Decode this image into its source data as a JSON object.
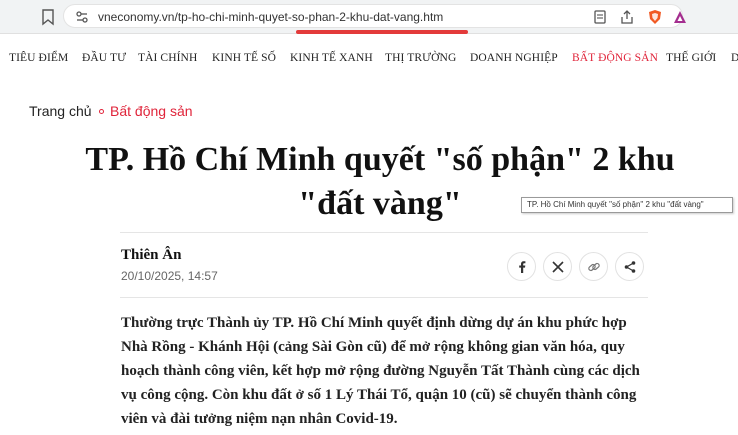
{
  "browser": {
    "url": "vneconomy.vn/tp-ho-chi-minh-quyet-so-phan-2-khu-dat-vang.htm",
    "icons": [
      "bookmark-icon",
      "site-settings-icon",
      "reader-mode-icon",
      "share-icon",
      "brave-shield-icon",
      "brave-rewards-icon"
    ]
  },
  "nav": {
    "items": [
      {
        "label": "TIÊU ĐIỂM"
      },
      {
        "label": "ĐẦU TƯ"
      },
      {
        "label": "TÀI CHÍNH"
      },
      {
        "label": "KINH TẾ SỐ"
      },
      {
        "label": "KINH TẾ XANH"
      },
      {
        "label": "THỊ TRƯỜNG"
      },
      {
        "label": "DOANH NGHIỆP"
      },
      {
        "label": "BẤT ĐỘNG SẢN"
      },
      {
        "label": "THẾ GIỚI"
      },
      {
        "label": "D"
      }
    ],
    "active_color": "#e0243a"
  },
  "breadcrumb": {
    "home": "Trang chủ",
    "category": "Bất động sản"
  },
  "article": {
    "title_line1": "TP. Hồ Chí Minh quyết \"số phận\" 2 khu",
    "title_line2": "\"đất vàng\"",
    "tooltip": "TP. Hồ Chí Minh quyết \"số phận\" 2 khu \"đất vàng\"",
    "author": "Thiên Ân",
    "date": "20/10/2025, 14:57",
    "share_icons": [
      "facebook-icon",
      "x-icon",
      "link-icon",
      "share-icon"
    ],
    "sapo": "Thường trực Thành ủy TP. Hồ Chí Minh quyết định dừng dự án khu phức hợp Nhà Rồng - Khánh Hội (cảng Sài Gòn cũ) để mở rộng không gian văn hóa, quy hoạch thành công viên, kết hợp mở rộng đường Nguyễn Tất Thành cùng các dịch vụ công cộng. Còn khu đất ở số 1 Lý Thái Tổ, quận 10 (cũ) sẽ chuyển thành công viên và đài tưởng niệm nạn nhân Covid-19."
  }
}
